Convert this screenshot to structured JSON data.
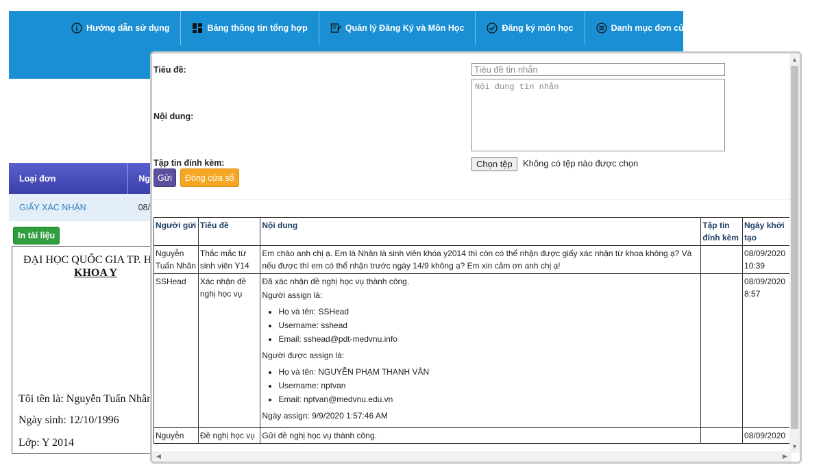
{
  "nav": {
    "items": [
      {
        "label": "Hướng dẫn sử dụng",
        "icon": "info-circle-icon"
      },
      {
        "label": "Bảng thông tin tổng hợp",
        "icon": "dashboard-icon"
      },
      {
        "label": "Quản lý Đăng Ký và Môn Học",
        "icon": "edit-icon"
      },
      {
        "label": "Đăng ký môn học",
        "icon": "check-circle-icon"
      },
      {
        "label": "Danh mục đơn của sinh viên",
        "icon": "list-circle-icon"
      }
    ]
  },
  "background": {
    "table_header": [
      "Loại đơn",
      "Ng"
    ],
    "row": {
      "type": "GIẤY XÁC NHẬN",
      "date": "08/"
    },
    "print_label": "In tài liệu",
    "doc": {
      "title": "ĐẠI HỌC QUỐC GIA TP. H",
      "sub": "KHOA Y",
      "name_line": "Tôi tên là: Nguyễn Tuấn Nhân",
      "dob_line": "Ngày sinh: 12/10/1996",
      "class_line": "Lớp: Y 2014"
    }
  },
  "modal": {
    "title_label": "Tiêu đề:",
    "title_placeholder": "Tiêu đề tin nhắn",
    "content_label": "Nội dung:",
    "content_placeholder": "Nội dung tin nhắn",
    "attach_label": "Tập tin đính kèm:",
    "file_button": "Chọn tệp",
    "file_status": "Không có tệp nào được chọn",
    "send_button": "Gửi",
    "close_button": "Đóng cửa sổ",
    "table": {
      "headers": [
        "Người gửi",
        "Tiêu đề",
        "Nội dung",
        "Tập tin đính kèm",
        "Ngày khởi tạo"
      ],
      "rows": [
        {
          "sender": "Nguyễn Tuấn Nhân",
          "title": "Thắc mắc từ sinh viên Y14",
          "content": "Em chào anh chị ạ. Em là Nhân là sinh viên khóa y2014 thì còn có thể nhận được giấy xác nhận từ khoa không ạ? Và nếu được thì em có thể nhận trước ngày 14/9 không ạ? Em xin cảm ơn anh chị ạ!",
          "attachment": "",
          "date": "08/09/2020 10:39"
        },
        {
          "sender": "SSHead",
          "title": "Xác nhận đề nghị học vụ",
          "content_intro": "Đã xác nhận đề nghị học vụ thành công.",
          "assigner_label": "Người assign là:",
          "assigner": [
            "Họ và tên: SSHead",
            "Username: sshead",
            "Email: sshead@pdt-medvnu.info"
          ],
          "assignee_label": "Người được assign là:",
          "assignee": [
            "Họ và tên: NGUYỄN PHẠM THANH VÂN",
            "Username: nptvan",
            "Email: nptvan@medvnu.edu.vn"
          ],
          "assign_date": "Ngày assign: 9/9/2020 1:57:46 AM",
          "attachment": "",
          "date": "08/09/2020 8:57"
        },
        {
          "sender": "Nguyễn",
          "title": "Đề nghị học vụ",
          "content": "Gửi đề nghị học vụ thành công.",
          "attachment": "",
          "date": "08/09/2020"
        }
      ]
    }
  }
}
